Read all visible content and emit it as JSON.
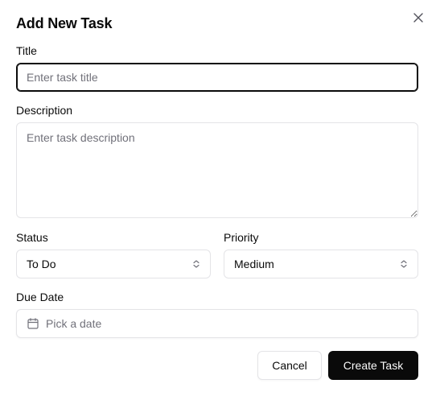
{
  "dialog": {
    "title": "Add New Task",
    "close_icon": "close-icon"
  },
  "fields": {
    "title": {
      "label": "Title",
      "placeholder": "Enter task title",
      "value": ""
    },
    "description": {
      "label": "Description",
      "placeholder": "Enter task description",
      "value": ""
    },
    "status": {
      "label": "Status",
      "selected": "To Do",
      "icon": "chevron-updown-icon"
    },
    "priority": {
      "label": "Priority",
      "selected": "Medium",
      "icon": "chevron-updown-icon"
    },
    "due_date": {
      "label": "Due Date",
      "placeholder": "Pick a date",
      "icon": "calendar-icon"
    }
  },
  "actions": {
    "cancel_label": "Cancel",
    "create_label": "Create Task"
  },
  "colors": {
    "primary": "#0a0a0a",
    "border": "#e4e4e7",
    "muted_text": "#71717a"
  }
}
